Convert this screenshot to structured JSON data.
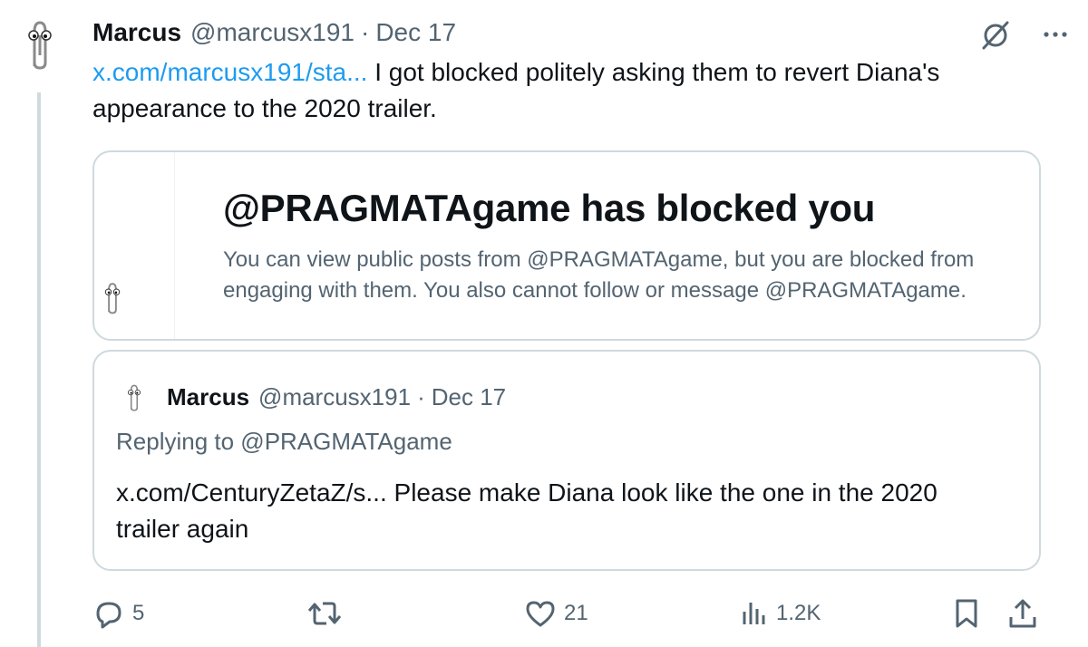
{
  "post": {
    "author": {
      "name": "Marcus",
      "handle": "@marcusx191",
      "separator": "·",
      "date": "Dec 17"
    },
    "link_text": "x.com/marcusx191/sta...",
    "text": " I got blocked politely asking them to revert Diana's appearance to the 2020 trailer."
  },
  "blocked_card": {
    "title": "@PRAGMATAgame has blocked you",
    "body": "You can view public posts from @PRAGMATAgame, but you are blocked from engaging with them. You also cannot follow or message @PRAGMATAgame."
  },
  "quoted_post": {
    "author": {
      "name": "Marcus",
      "handle": "@marcusx191",
      "separator": "·",
      "date": "Dec 17"
    },
    "replying": "Replying to @PRAGMATAgame",
    "text": "x.com/CenturyZetaZ/s... Please make Diana look like the one in the 2020 trailer again"
  },
  "actions": {
    "replies": "5",
    "reposts": "",
    "likes": "21",
    "views": "1.2K"
  },
  "icons": {
    "avatar": "paperclip-icon",
    "grok": "grok-icon",
    "more": "more-icon",
    "reply": "reply-icon",
    "repost": "repost-icon",
    "like": "heart-icon",
    "views": "views-icon",
    "bookmark": "bookmark-icon",
    "share": "share-icon"
  },
  "colors": {
    "text": "#0f1419",
    "secondary": "#536471",
    "link": "#1d9bf0",
    "border": "#cfd9de"
  }
}
